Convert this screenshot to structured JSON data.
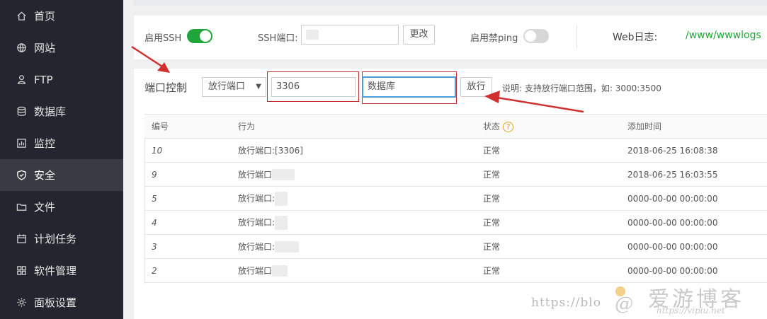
{
  "sidebar": {
    "items": [
      {
        "label": "首页",
        "icon": "home-icon"
      },
      {
        "label": "网站",
        "icon": "globe-icon"
      },
      {
        "label": "FTP",
        "icon": "ftp-icon"
      },
      {
        "label": "数据库",
        "icon": "database-icon"
      },
      {
        "label": "监控",
        "icon": "monitor-icon"
      },
      {
        "label": "安全",
        "icon": "shield-icon"
      },
      {
        "label": "文件",
        "icon": "folder-icon"
      },
      {
        "label": "计划任务",
        "icon": "calendar-icon"
      },
      {
        "label": "软件管理",
        "icon": "grid-icon"
      },
      {
        "label": "面板设置",
        "icon": "gear-icon"
      }
    ],
    "active": "安全"
  },
  "ssh": {
    "enable_label": "启用SSH",
    "enabled": true,
    "port_label": "SSH端口:",
    "port_value": "",
    "change_label": "更改",
    "ping_label": "启用禁ping",
    "ping_enabled": false,
    "weblog_label": "Web日志:",
    "weblog_path": "/www/wwwlogs"
  },
  "port_control": {
    "title": "端口控制",
    "action_select": "放行端口",
    "port_value": "3306",
    "remark_value": "数据库",
    "submit_label": "放行",
    "note": "说明: 支持放行端口范围，如: 3000:3500"
  },
  "table": {
    "headers": [
      "编号",
      "行为",
      "状态",
      "添加时间"
    ],
    "rows": [
      {
        "id": "10",
        "action": "放行端口:[3306]",
        "status": "正常",
        "time": "2018-06-25 16:08:38"
      },
      {
        "id": "9",
        "action": "放行端口",
        "status": "正常",
        "time": "2018-06-25 16:03:55"
      },
      {
        "id": "5",
        "action": "放行端口:",
        "status": "正常",
        "time": "0000-00-00 00:00:00"
      },
      {
        "id": "4",
        "action": "放行端口:",
        "status": "正常",
        "time": "0000-00-00 00:00:00"
      },
      {
        "id": "3",
        "action": "放行端口:",
        "status": "正常",
        "time": "0000-00-00 00:00:00"
      },
      {
        "id": "2",
        "action": "放行端口",
        "status": "正常",
        "time": "0000-00-00 00:00:00"
      }
    ]
  },
  "watermark": {
    "url_text": "https://blo",
    "brand": "爱游博客",
    "brand_url": "https://vipiu.net"
  },
  "colors": {
    "sidebar_bg": "#23262e",
    "sidebar_active": "#383b43",
    "accent_green": "#20a53a",
    "annotation_red": "#d03030"
  }
}
